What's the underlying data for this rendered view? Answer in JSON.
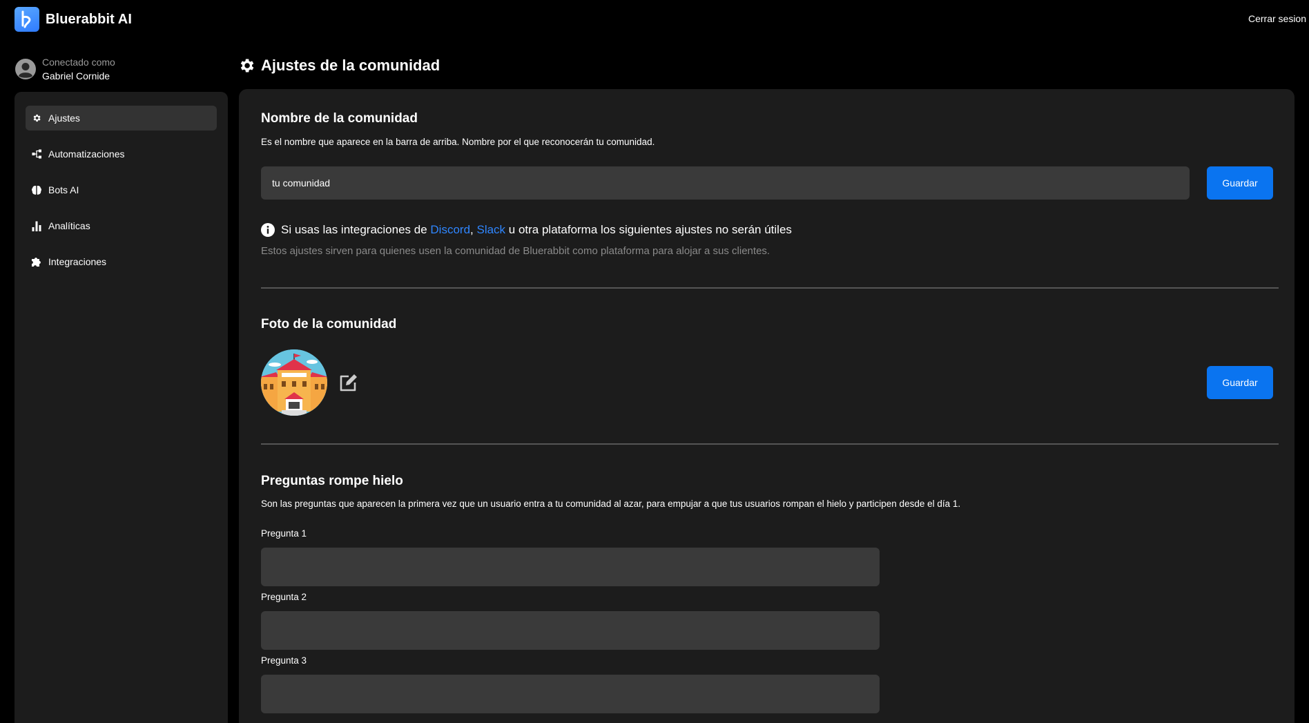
{
  "header": {
    "brand_name": "Bluerabbit AI",
    "logout_label": "Cerrar sesion"
  },
  "user": {
    "caption": "Conectado como",
    "name": "Gabriel Cornide"
  },
  "sidebar": {
    "items": [
      {
        "label": "Ajustes",
        "icon": "gear-icon",
        "active": true
      },
      {
        "label": "Automatizaciones",
        "icon": "workflow-icon",
        "active": false
      },
      {
        "label": "Bots AI",
        "icon": "brain-icon",
        "active": false
      },
      {
        "label": "Analíticas",
        "icon": "bar-chart-icon",
        "active": false
      },
      {
        "label": "Integraciones",
        "icon": "puzzle-icon",
        "active": false
      }
    ]
  },
  "page": {
    "title": "Ajustes de la comunidad"
  },
  "community_name": {
    "title": "Nombre de la comunidad",
    "description": "Es el nombre que aparece en la barra de arriba. Nombre por el que reconocerán tu comunidad.",
    "placeholder": "tu comunidad",
    "value": "",
    "save_label": "Guardar"
  },
  "integrations_notice": {
    "prefix": "Si usas las integraciones de ",
    "link_discord": "Discord",
    "separator": ", ",
    "link_slack": "Slack",
    "suffix": " u otra plataforma los siguientes ajustes no serán útiles",
    "subtext": "Estos ajustes sirven para quienes usen la comunidad de Bluerabbit como plataforma para alojar a sus clientes."
  },
  "community_photo": {
    "title": "Foto de la comunidad",
    "save_label": "Guardar"
  },
  "icebreakers": {
    "title": "Preguntas rompe hielo",
    "description": "Son las preguntas que aparecen la primera vez que un usuario entra a tu comunidad al azar, para empujar a que tus usuarios rompan el hielo y participen desde el día 1.",
    "questions": [
      {
        "label": "Pregunta 1",
        "value": ""
      },
      {
        "label": "Pregunta 2",
        "value": ""
      },
      {
        "label": "Pregunta 3",
        "value": ""
      }
    ]
  },
  "colors": {
    "accent": "#0a74f0",
    "link": "#2f86ff",
    "panel": "#1c1c1c",
    "input": "#3a3a3a",
    "background": "#000000"
  }
}
